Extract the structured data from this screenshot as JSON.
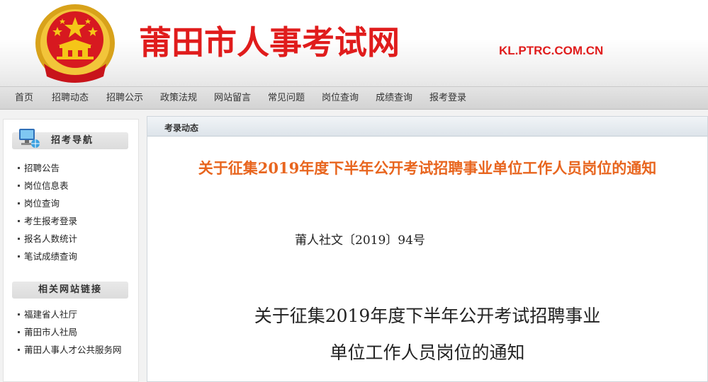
{
  "header": {
    "site_title": "莆田市人事考试网",
    "site_url": "KL.PTRC.COM.CN"
  },
  "nav": {
    "items": [
      "首页",
      "招聘动态",
      "招聘公示",
      "政策法规",
      "网站留言",
      "常见问题",
      "岗位查询",
      "成绩查询",
      "报考登录"
    ]
  },
  "sidebar": {
    "nav_heading": "招考导航",
    "nav_items": [
      "招聘公告",
      "岗位信息表",
      "岗位查询",
      "考生报考登录",
      "报名人数统计",
      "笔试成绩查询"
    ],
    "links_heading": "相关网站链接",
    "link_items": [
      "福建省人社厅",
      "莆田市人社局",
      "莆田人事人才公共服务网"
    ]
  },
  "main": {
    "section_label": "考录动态",
    "article_title": "关于征集2019年度下半年公开考试招聘事业单位工作人员岗位的通知",
    "doc_number": "莆人社文〔2019〕94号",
    "body_title_line1": "关于征集2019年度下半年公开考试招聘事业",
    "body_title_line2": "单位工作人员岗位的通知"
  },
  "colors": {
    "brand_red": "#e01c1c",
    "title_orange": "#e8651e",
    "nav_bg": "#dcdcdc"
  },
  "icons": {
    "emblem": "national-emblem",
    "nav_heading_icon": "computer-icon"
  }
}
